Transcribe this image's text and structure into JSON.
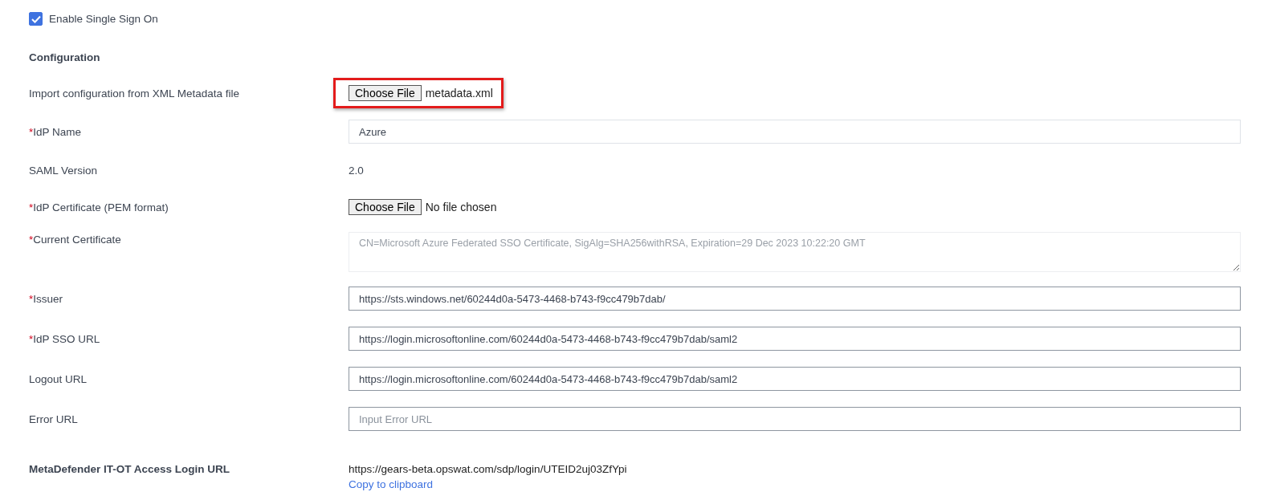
{
  "enable_sso": {
    "label": "Enable Single Sign On",
    "checked": true
  },
  "section_title": "Configuration",
  "rows": [
    {
      "kind": "file",
      "label": "Import configuration from XML Metadata file",
      "button": "Choose File",
      "file_name": "metadata.xml",
      "highlighted": true
    },
    {
      "kind": "input",
      "required_mark": "*",
      "label": "IdP Name",
      "value": "Azure"
    },
    {
      "kind": "text",
      "label": "SAML Version",
      "value": "2.0"
    },
    {
      "kind": "file",
      "required_mark": "*",
      "label": "IdP Certificate (PEM format)",
      "button": "Choose File",
      "file_name": "No file chosen",
      "highlighted": false
    },
    {
      "kind": "textarea",
      "required_mark": "*",
      "label": "Current Certificate",
      "value": "CN=Microsoft Azure Federated SSO Certificate, SigAlg=SHA256withRSA, Expiration=29 Dec 2023 10:22:20 GMT",
      "disabled": true
    },
    {
      "kind": "input",
      "required_mark": "*",
      "label": "Issuer",
      "value": "https://sts.windows.net/60244d0a-5473-4468-b743-f9cc479b7dab/"
    },
    {
      "kind": "input",
      "required_mark": "*",
      "label": "IdP SSO URL",
      "value": "https://login.microsoftonline.com/60244d0a-5473-4468-b743-f9cc479b7dab/saml2"
    },
    {
      "kind": "input",
      "label": "Logout URL",
      "value": "https://login.microsoftonline.com/60244d0a-5473-4468-b743-f9cc479b7dab/saml2"
    },
    {
      "kind": "input",
      "label": "Error URL",
      "placeholder": "Input Error URL"
    }
  ],
  "login_url": {
    "label": "MetaDefender IT-OT Access Login URL",
    "value": "https://gears-beta.opswat.com/sdp/login/UTEID2uj03ZfYpi",
    "link": "Copy to clipboard"
  }
}
